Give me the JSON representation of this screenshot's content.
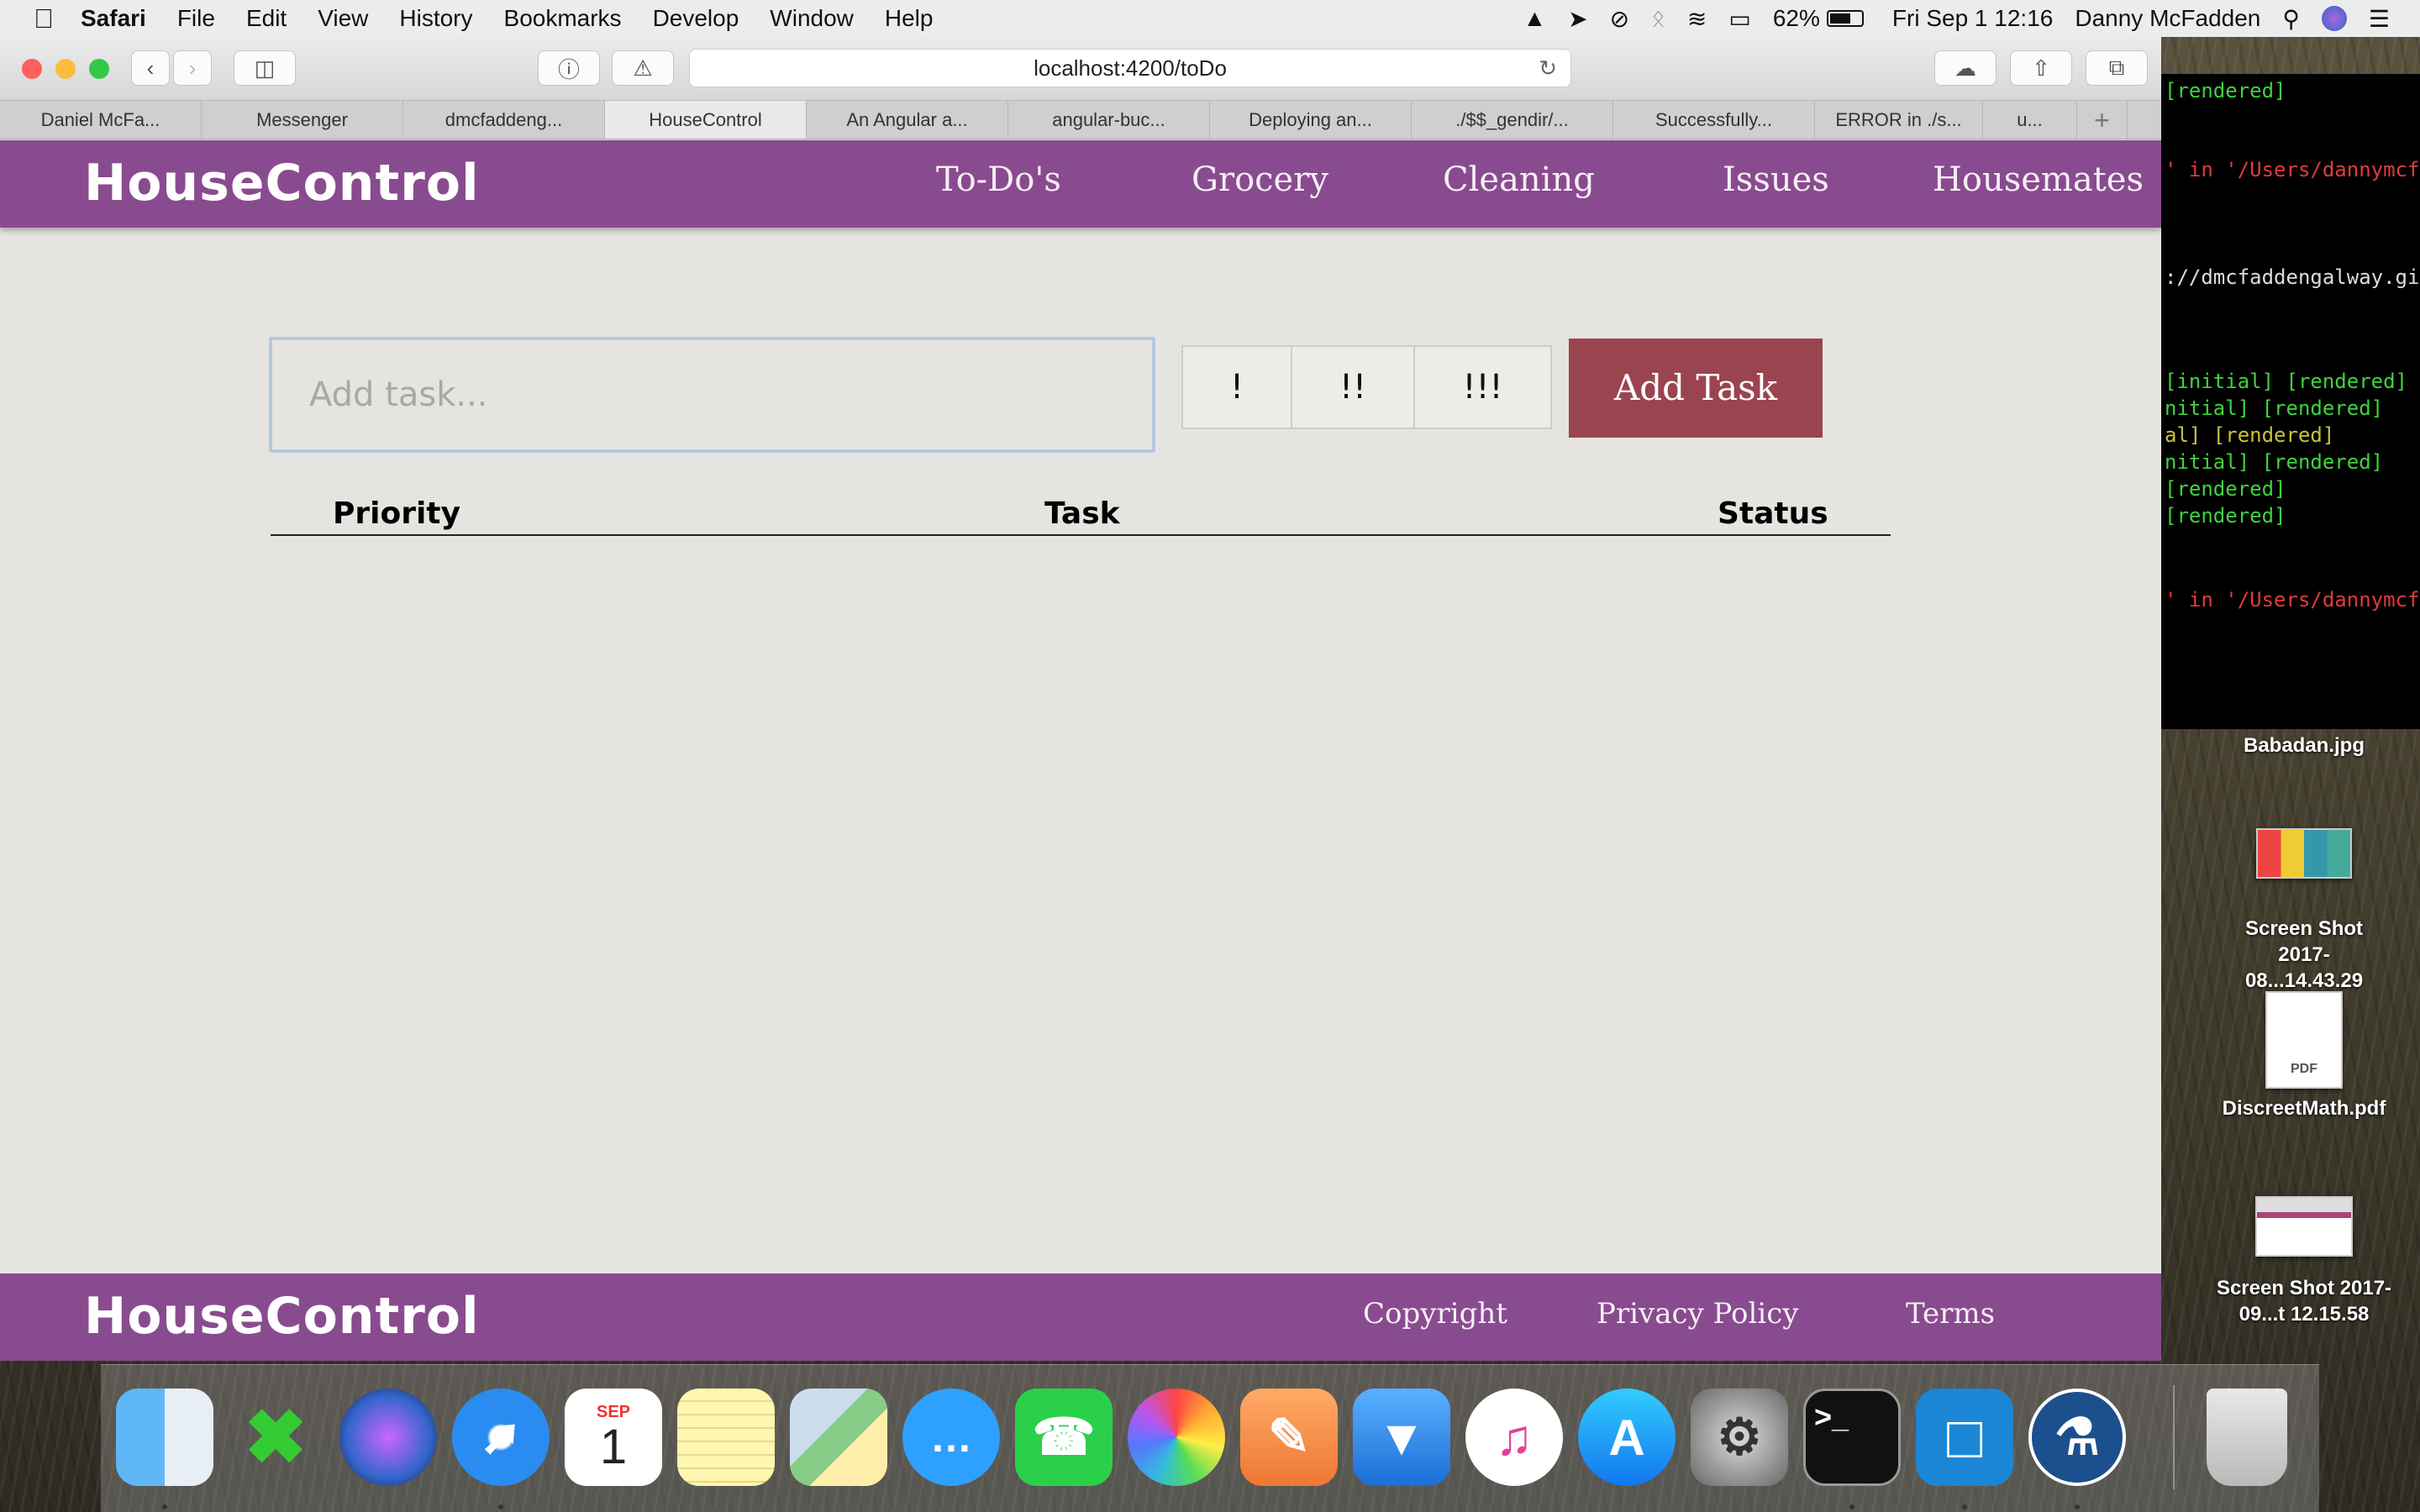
{
  "menubar": {
    "app_name": "Safari",
    "items": [
      "File",
      "Edit",
      "View",
      "History",
      "Bookmarks",
      "Develop",
      "Window",
      "Help"
    ],
    "battery": "62%",
    "clock": "Fri Sep 1  12:16",
    "user": "Danny McFadden"
  },
  "browser": {
    "url": "localhost:4200/toDo",
    "tabs": [
      "Daniel McFa...",
      "Messenger",
      "dmcfaddeng...",
      "HouseControl",
      "An Angular a...",
      "angular-buc...",
      "Deploying an...",
      "./$$_gendir/...",
      "Successfully...",
      "ERROR in ./s...",
      "u..."
    ],
    "active_tab": 3
  },
  "app": {
    "brand": "HouseControl",
    "nav": [
      "To-Do's",
      "Grocery",
      "Cleaning",
      "Issues",
      "Housemates"
    ],
    "task_placeholder": "Add task...",
    "priority_buttons": [
      "!",
      "!!",
      "!!!"
    ],
    "add_button": "Add Task",
    "table_headers": {
      "priority": "Priority",
      "task": "Task",
      "status": "Status"
    },
    "footer_brand": "HouseControl",
    "footer_links": [
      "Copyright",
      "Privacy Policy",
      "Terms"
    ]
  },
  "terminal": {
    "lines": [
      {
        "text": "[rendered]",
        "color": "green"
      },
      {
        "text": "' in '/Users/dannymcf",
        "color": "red"
      },
      {
        "text": "://dmcfaddengalway.gi",
        "color": "white"
      },
      {
        "text": " [initial] [rendered]",
        "color": "green"
      },
      {
        "text": "nitial] [rendered]",
        "color": "green"
      },
      {
        "text": "al] [rendered]",
        "color": "green"
      },
      {
        "text": "nitial] [rendered]",
        "color": "green"
      },
      {
        "text": " [rendered]",
        "color": "green"
      },
      {
        "text": "[rendered]",
        "color": "green"
      },
      {
        "text": "' in '/Users/dannymcf",
        "color": "red"
      }
    ]
  },
  "desktop": {
    "icons": [
      {
        "name": "Babadan.jpg"
      },
      {
        "name": "Screen Shot 2017-08...14.43.29"
      },
      {
        "name": "DiscreetMath.pdf"
      },
      {
        "name": "Screen Shot 2017-09...t 12.15.58"
      }
    ],
    "pdf_badge": "PDF"
  },
  "dock": {
    "apps": [
      "finder-icon",
      "xquartz-icon",
      "siri-icon",
      "safari-icon",
      "calendar-icon",
      "notes-icon",
      "maps-icon",
      "messages-icon",
      "facetime-icon",
      "photos-icon",
      "pages-icon",
      "keynote-icon",
      "itunes-icon",
      "app-store-icon",
      "system-preferences-icon",
      "terminal-icon",
      "brackets-icon",
      "sourcetree-icon",
      "trash-icon"
    ],
    "calendar_month": "SEP",
    "calendar_day": "1"
  }
}
